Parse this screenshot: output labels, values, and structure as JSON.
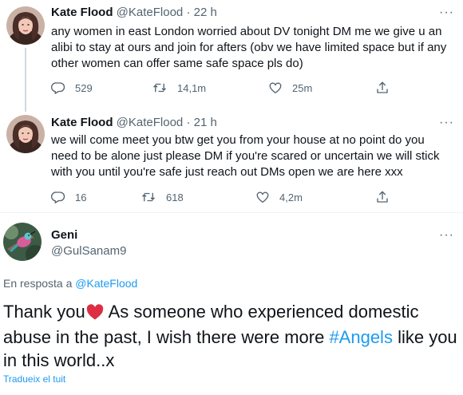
{
  "tweets": [
    {
      "name": "Kate Flood",
      "handle": "@KateFlood",
      "dot": "·",
      "time": "22 h",
      "text": "any women in east London worried about DV tonight DM me we give u an alibi to stay at ours and join for afters (obv we have limited space but if any other women can offer same safe space pls do)",
      "replies": "529",
      "retweets": "14,1m",
      "likes": "25m"
    },
    {
      "name": "Kate Flood",
      "handle": "@KateFlood",
      "dot": "·",
      "time": "21 h",
      "text": "we will come meet you btw get you from your house at no point do you need to be alone just please DM if you're scared or uncertain we will stick with you until you're safe just reach out DMs open we are here xxx",
      "replies": "16",
      "retweets": "618",
      "likes": "4,2m"
    }
  ],
  "main_tweet": {
    "name": "Geni",
    "handle": "@GulSanam9",
    "reply_prefix": "En resposta a",
    "reply_handle": "@KateFlood",
    "text_part1": "Thank you",
    "text_part2": " As someone who experienced domestic abuse in the past, I wish there were more ",
    "hashtag": "#Angels",
    "text_part3": " like you in this world..x",
    "translate_link": "Tradueix el tuit"
  },
  "more_glyph": "···",
  "icons": {
    "reply": "reply-icon",
    "retweet": "retweet-icon",
    "like": "heart-icon",
    "share": "share-icon",
    "more": "more-icon",
    "emoji": "red-heart-emoji"
  },
  "colors": {
    "accent": "#1d9bf0",
    "secondary_text": "#536471",
    "emoji_heart": "#dd2e44"
  }
}
